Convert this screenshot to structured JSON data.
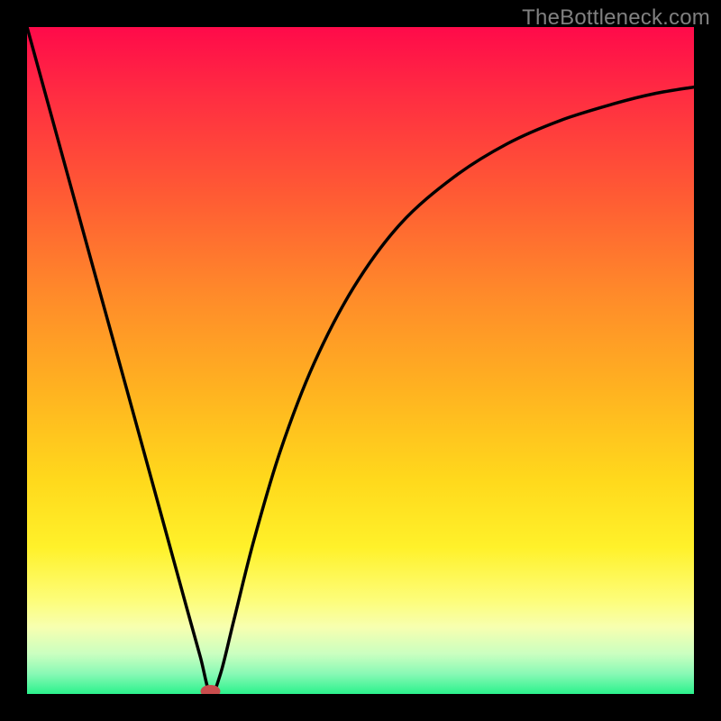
{
  "watermark": {
    "text": "TheBottleneck.com"
  },
  "chart_data": {
    "type": "line",
    "title": "",
    "xlabel": "",
    "ylabel": "",
    "xlim": [
      0,
      1
    ],
    "ylim": [
      0,
      1
    ],
    "series": [
      {
        "name": "bottleneck-curve",
        "x": [
          0.0,
          0.05,
          0.1,
          0.15,
          0.2,
          0.24,
          0.26,
          0.275,
          0.29,
          0.31,
          0.34,
          0.38,
          0.43,
          0.49,
          0.56,
          0.64,
          0.72,
          0.8,
          0.88,
          0.94,
          1.0
        ],
        "values": [
          1.0,
          0.818,
          0.636,
          0.455,
          0.273,
          0.127,
          0.055,
          0.0,
          0.03,
          0.11,
          0.23,
          0.365,
          0.495,
          0.61,
          0.705,
          0.775,
          0.825,
          0.86,
          0.885,
          0.9,
          0.91
        ]
      }
    ],
    "annotations": [
      {
        "name": "minimum-marker",
        "x": 0.275,
        "y": 0.0
      }
    ],
    "background_gradient": {
      "stops": [
        {
          "pos": 0.0,
          "color": "#ff0a4a"
        },
        {
          "pos": 0.1,
          "color": "#ff2c42"
        },
        {
          "pos": 0.25,
          "color": "#ff5a34"
        },
        {
          "pos": 0.4,
          "color": "#ff8a2a"
        },
        {
          "pos": 0.55,
          "color": "#ffb420"
        },
        {
          "pos": 0.68,
          "color": "#ffd91c"
        },
        {
          "pos": 0.78,
          "color": "#fff12a"
        },
        {
          "pos": 0.86,
          "color": "#fdfd7a"
        },
        {
          "pos": 0.9,
          "color": "#f7ffb0"
        },
        {
          "pos": 0.94,
          "color": "#caffc0"
        },
        {
          "pos": 0.97,
          "color": "#88f9b5"
        },
        {
          "pos": 1.0,
          "color": "#2bf28c"
        }
      ]
    }
  }
}
